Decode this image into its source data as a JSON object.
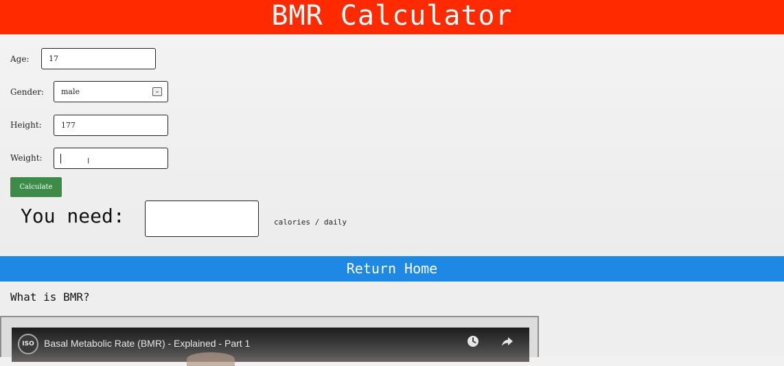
{
  "header": {
    "title": "BMR Calculator"
  },
  "form": {
    "age": {
      "label": "Age:",
      "value": "17"
    },
    "gender": {
      "label": "Gender:",
      "value": "male"
    },
    "height": {
      "label": "Height:",
      "value": "177"
    },
    "weight": {
      "label": "Weight:",
      "value": ""
    },
    "calculate_label": "Calculate"
  },
  "result": {
    "label": "You need:",
    "value": "",
    "unit": "calories / daily"
  },
  "nav": {
    "return_home": "Return Home"
  },
  "info": {
    "title": "What is BMR?",
    "video": {
      "title": "Basal Metabolic Rate (BMR) - Explained - Part 1",
      "channel_logo": "ISO",
      "watch_later_icon": "clock-icon",
      "share_icon": "share-icon"
    }
  },
  "colors": {
    "header_bg": "#ff2a00",
    "button_bg": "#3d8b48",
    "return_bar_bg": "#1e88e5"
  }
}
